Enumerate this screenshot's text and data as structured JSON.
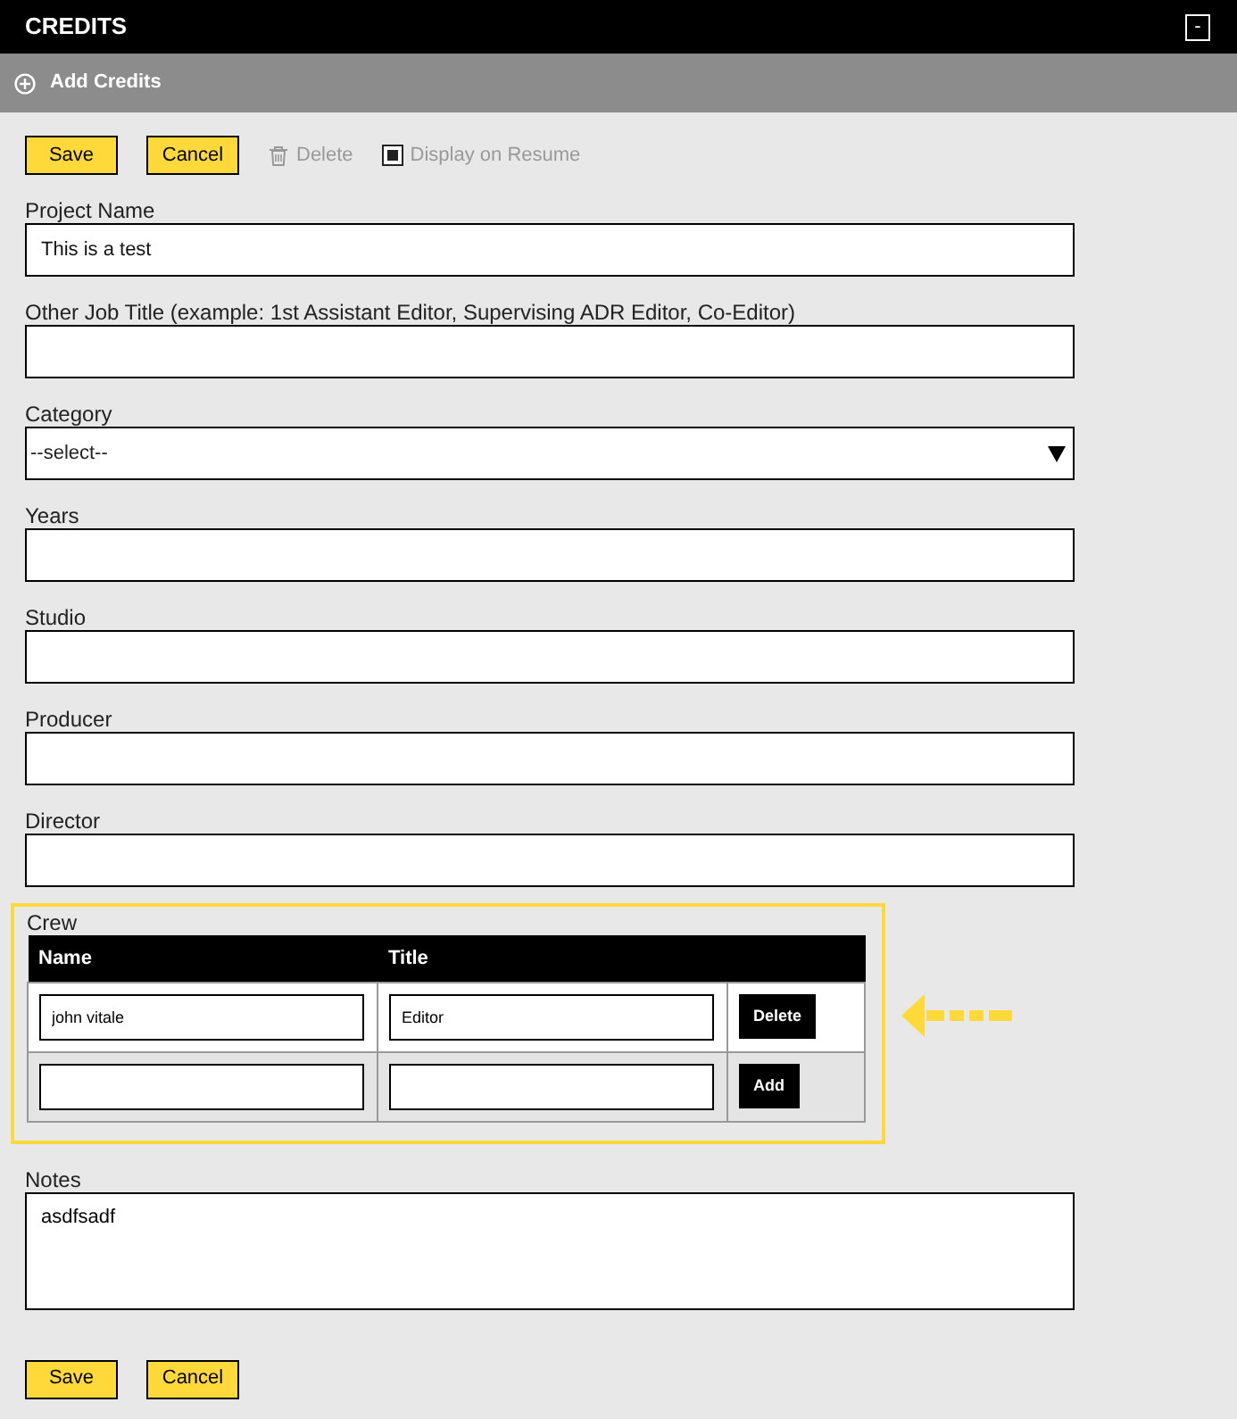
{
  "header": {
    "title": "CREDITS",
    "collapse_label": "-"
  },
  "section": {
    "title": "Add Credits"
  },
  "toolbar": [
    {
      "kind": "button",
      "label": "Save"
    },
    {
      "kind": "button",
      "label": "Cancel"
    },
    {
      "kind": "delete",
      "label": "Delete",
      "disabled": true
    },
    {
      "kind": "checkbox",
      "label": "Display on Resume",
      "checked": true,
      "disabled": true
    }
  ],
  "fields": [
    {
      "kind": "text",
      "label": "Project Name",
      "value": "This is a test"
    },
    {
      "kind": "text",
      "label": "Other Job Title (example: 1st Assistant Editor, Supervising ADR Editor, Co-Editor)"
    },
    {
      "kind": "select",
      "label": "Category",
      "value": "--select--"
    },
    {
      "kind": "text",
      "label": "Years"
    },
    {
      "kind": "text",
      "label": "Studio"
    },
    {
      "kind": "text",
      "label": "Producer"
    },
    {
      "kind": "text",
      "label": "Director"
    }
  ],
  "crew": {
    "label": "Crew",
    "highlighted": true,
    "columns": [
      "Name",
      "Title"
    ],
    "rows": [
      {
        "name": "john vitale",
        "title": "Editor",
        "action": "Delete"
      },
      {
        "action": "Add"
      }
    ]
  },
  "notes": {
    "label": "Notes",
    "value": "asdfsadf"
  },
  "footer_buttons": [
    "Save",
    "Cancel"
  ]
}
